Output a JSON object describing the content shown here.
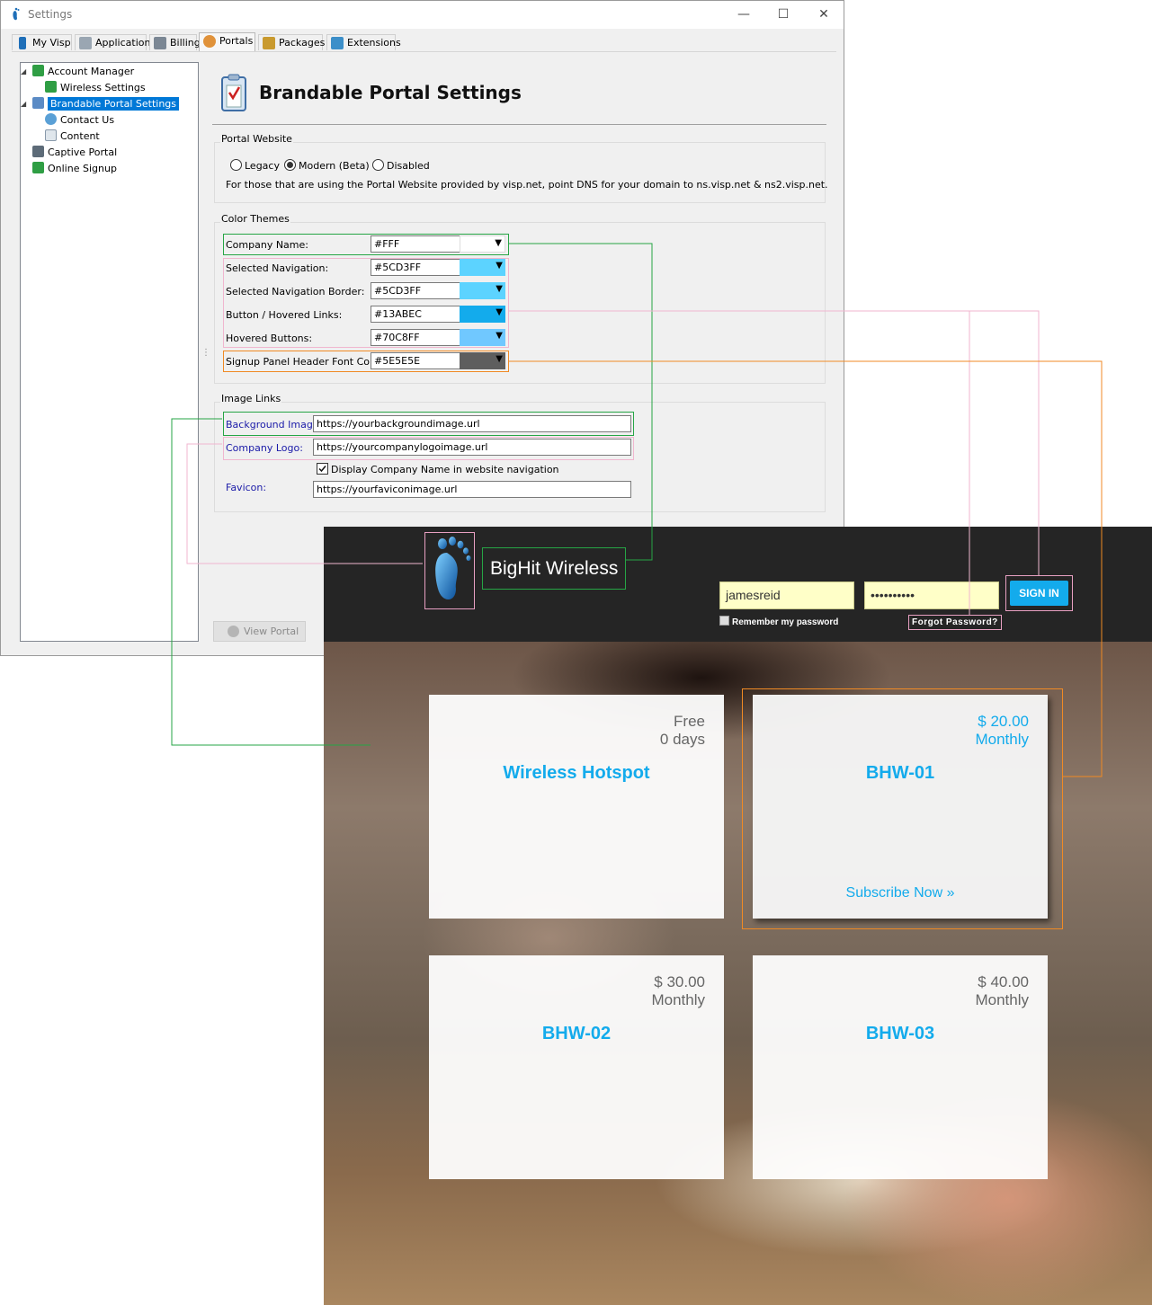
{
  "window": {
    "title": "Settings",
    "controls": {
      "minimize": "—",
      "maximize": "☐",
      "close": "✕"
    }
  },
  "tabs": [
    {
      "label": "My Visp",
      "icon": "foot-icon"
    },
    {
      "label": "Application",
      "icon": "app-icon"
    },
    {
      "label": "Billing",
      "icon": "billing-icon"
    },
    {
      "label": "Portals",
      "icon": "portals-icon",
      "active": true
    },
    {
      "label": "Packages",
      "icon": "package-icon"
    },
    {
      "label": "Extensions",
      "icon": "extensions-icon"
    }
  ],
  "tree": [
    {
      "label": "Account Manager",
      "icon": "user-icon"
    },
    {
      "label": "Wireless Settings",
      "icon": "user-icon"
    },
    {
      "label": "Brandable Portal Settings",
      "icon": "clipboard-icon",
      "selected": true
    },
    {
      "label": "Contact Us",
      "icon": "globe-icon"
    },
    {
      "label": "Content",
      "icon": "page-icon"
    },
    {
      "label": "Captive Portal",
      "icon": "monitor-icon"
    },
    {
      "label": "Online Signup",
      "icon": "user-icon"
    }
  ],
  "page": {
    "title": "Brandable Portal Settings"
  },
  "portal_website": {
    "group_label": "Portal Website",
    "options": [
      "Legacy",
      "Modern (Beta)",
      "Disabled"
    ],
    "selected": "Modern (Beta)",
    "note": "For those that are using the Portal Website provided by visp.net, point DNS for your domain to ns.visp.net & ns2.visp.net."
  },
  "color_themes": {
    "group_label": "Color Themes",
    "rows": [
      {
        "label": "Company Name:",
        "value": "#FFF",
        "color": "#FFFFFF"
      },
      {
        "label": "Selected Navigation:",
        "value": "#5CD3FF",
        "color": "#5CD3FF"
      },
      {
        "label": "Selected Navigation Border:",
        "value": "#5CD3FF",
        "color": "#5CD3FF"
      },
      {
        "label": "Button / Hovered Links:",
        "value": "#13ABEC",
        "color": "#13ABEC"
      },
      {
        "label": "Hovered Buttons:",
        "value": "#70C8FF",
        "color": "#70C8FF"
      },
      {
        "label": "Signup Panel Header Font Color:",
        "value": "#5E5E5E",
        "color": "#5E5E5E"
      }
    ]
  },
  "image_links": {
    "group_label": "Image Links",
    "background_label": "Background Image:",
    "background_value": "https://yourbackgroundimage.url",
    "logo_label": "Company Logo:",
    "logo_value": "https://yourcompanylogoimage.url",
    "display_name_label": "Display Company Name in website navigation",
    "display_name_checked": true,
    "favicon_label": "Favicon:",
    "favicon_value": "https://yourfaviconimage.url"
  },
  "view_portal_label": "View Portal",
  "portal": {
    "brand": "BigHit Wireless",
    "username": "jamesreid",
    "password": "••••••••••",
    "signin_label": "SIGN IN",
    "remember_label": "Remember my password",
    "forgot_label": "Forgot Password?",
    "cards": [
      {
        "price": "Free",
        "period": "0 days",
        "name": "Wireless Hotspot"
      },
      {
        "price": "$ 20.00",
        "period": "Monthly",
        "name": "BHW-01",
        "subscribe": "Subscribe Now »"
      },
      {
        "price": "$ 30.00",
        "period": "Monthly",
        "name": "BHW-02"
      },
      {
        "price": "$ 40.00",
        "period": "Monthly",
        "name": "BHW-03"
      }
    ]
  },
  "colors": {
    "accent": "#13ABEC",
    "nav_bg": "#252525",
    "annotation_green": "#26A545",
    "annotation_pink": "#E8A0C2",
    "annotation_orange": "#F08A24"
  }
}
